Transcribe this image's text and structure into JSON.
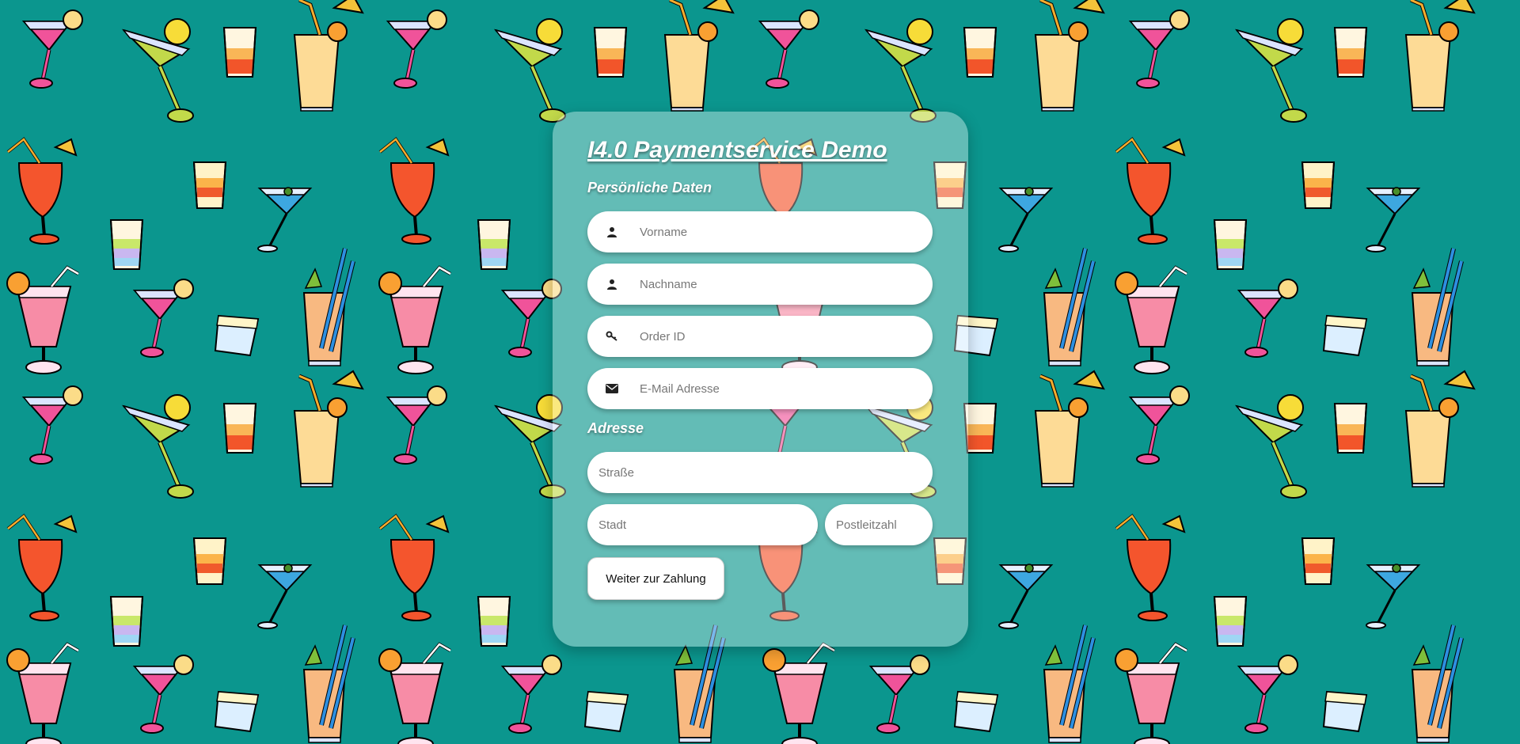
{
  "form": {
    "title": "I4.0 Paymentservice Demo",
    "personal_section": "Persönliche Daten",
    "address_section": "Adresse",
    "fields": {
      "first_name": {
        "placeholder": "Vorname",
        "icon": "user-icon"
      },
      "last_name": {
        "placeholder": "Nachname",
        "icon": "user-icon"
      },
      "order_id": {
        "placeholder": "Order ID",
        "icon": "key-icon"
      },
      "email": {
        "placeholder": "E-Mail Adresse",
        "icon": "envelope-icon"
      },
      "street": {
        "placeholder": "Straße"
      },
      "city": {
        "placeholder": "Stadt"
      },
      "zip": {
        "placeholder": "Postleitzahl"
      }
    },
    "submit_label": "Weiter zur Zahlung"
  },
  "theme": {
    "background": "#0b968e",
    "card_background": "rgba(255,255,255,0.36)",
    "text_on_card": "#ffffff"
  }
}
